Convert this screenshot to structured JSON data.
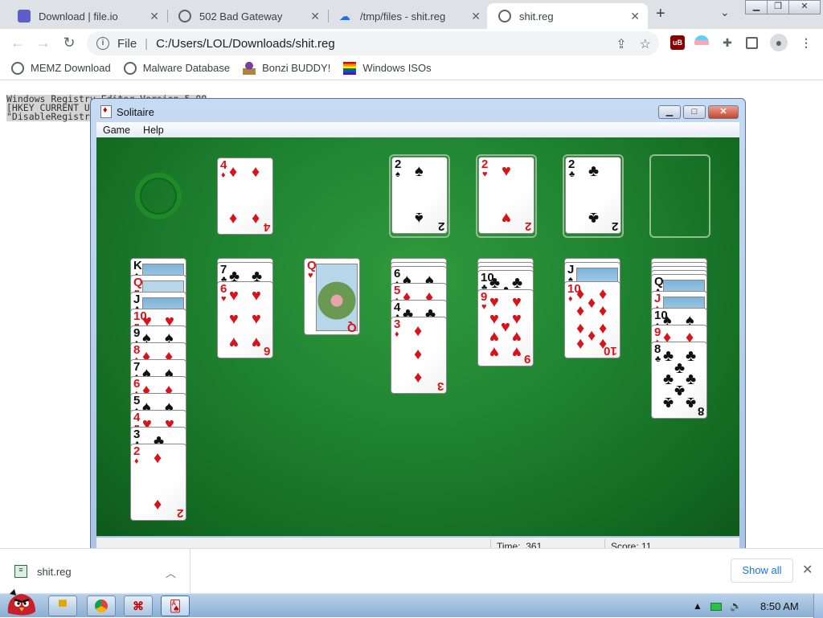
{
  "browser": {
    "tabs": [
      {
        "title": "Download | file.io",
        "favicon_color": "#5b5fc7"
      },
      {
        "title": "502 Bad Gateway",
        "favicon_color": "#5f6368"
      },
      {
        "title": "/tmp/files - shit.reg",
        "favicon_color": "#1a73e8"
      },
      {
        "title": "shit.reg",
        "favicon_color": "#5f6368"
      }
    ],
    "new_tab": "+",
    "tab_menu": "⌄",
    "window_controls": {
      "minimize": "▁",
      "restore": "❐",
      "close": "✕"
    },
    "omnibox": {
      "scheme": "File",
      "separator": "|",
      "url": "C:/Users/LOL/Downloads/shit.reg"
    },
    "bookmarks": [
      {
        "label": "MEMZ Download",
        "icon": "globe-icon"
      },
      {
        "label": "Malware Database",
        "icon": "globe-icon"
      },
      {
        "label": "Bonzi BUDDY!",
        "icon": "bonzi-icon"
      },
      {
        "label": "Windows ISOs",
        "icon": "rainbow-flag-icon"
      }
    ]
  },
  "page_text": {
    "line1": "Windows Registry Editor Version 5.00",
    "line2": "[HKEY_CURRENT_U",
    "line3": "\"DisableRegistr"
  },
  "solitaire": {
    "title": "Solitaire",
    "menu": [
      "Game",
      "Help"
    ],
    "status": {
      "time_label": "Time:",
      "time_value": "361",
      "score_label": "Score:",
      "score_value": "11"
    },
    "waste": {
      "rank": "4",
      "suit": "♦",
      "color": "red"
    },
    "foundations": [
      {
        "rank": "2",
        "suit": "♠",
        "color": "blk"
      },
      {
        "rank": "2",
        "suit": "♥",
        "color": "red"
      },
      {
        "rank": "2",
        "suit": "♣",
        "color": "blk"
      },
      {
        "rank": "",
        "suit": "",
        "color": "empty"
      }
    ],
    "tableau": [
      {
        "face_down": 0,
        "cards": [
          {
            "rank": "K",
            "suit": "♠",
            "color": "blk"
          },
          {
            "rank": "Q",
            "suit": "♥",
            "color": "red"
          },
          {
            "rank": "J",
            "suit": "♣",
            "color": "blk"
          },
          {
            "rank": "10",
            "suit": "♥",
            "color": "red"
          },
          {
            "rank": "9",
            "suit": "♠",
            "color": "blk"
          },
          {
            "rank": "8",
            "suit": "♦",
            "color": "red"
          },
          {
            "rank": "7",
            "suit": "♠",
            "color": "blk"
          },
          {
            "rank": "6",
            "suit": "♦",
            "color": "red"
          },
          {
            "rank": "5",
            "suit": "♠",
            "color": "blk"
          },
          {
            "rank": "4",
            "suit": "♥",
            "color": "red"
          },
          {
            "rank": "3",
            "suit": "♣",
            "color": "blk"
          },
          {
            "rank": "2",
            "suit": "♦",
            "color": "red"
          }
        ]
      },
      {
        "face_down": 1,
        "cards": [
          {
            "rank": "7",
            "suit": "♣",
            "color": "blk"
          },
          {
            "rank": "6",
            "suit": "♥",
            "color": "red"
          }
        ]
      },
      {
        "face_down": 0,
        "cards": [
          {
            "rank": "Q",
            "suit": "♥",
            "color": "red"
          }
        ]
      },
      {
        "face_down": 2,
        "cards": [
          {
            "rank": "6",
            "suit": "♠",
            "color": "blk"
          },
          {
            "rank": "5",
            "suit": "♦",
            "color": "red"
          },
          {
            "rank": "4",
            "suit": "♣",
            "color": "blk"
          },
          {
            "rank": "3",
            "suit": "♦",
            "color": "red"
          }
        ]
      },
      {
        "face_down": 3,
        "cards": [
          {
            "rank": "10",
            "suit": "♣",
            "color": "blk"
          },
          {
            "rank": "9",
            "suit": "♥",
            "color": "red"
          }
        ]
      },
      {
        "face_down": 1,
        "cards": [
          {
            "rank": "J",
            "suit": "♠",
            "color": "blk"
          },
          {
            "rank": "10",
            "suit": "♦",
            "color": "red"
          }
        ]
      },
      {
        "face_down": 4,
        "cards": [
          {
            "rank": "Q",
            "suit": "♣",
            "color": "blk"
          },
          {
            "rank": "J",
            "suit": "♦",
            "color": "red"
          },
          {
            "rank": "10",
            "suit": "♠",
            "color": "blk"
          },
          {
            "rank": "9",
            "suit": "♦",
            "color": "red"
          },
          {
            "rank": "8",
            "suit": "♣",
            "color": "blk"
          }
        ]
      }
    ]
  },
  "downloads": {
    "file": "shit.reg",
    "show_all": "Show all",
    "close": "✕"
  },
  "taskbar": {
    "clock": "8:50 AM"
  },
  "colors": {
    "felt": "#1f8230",
    "red_suit": "#d8141a",
    "link_blue": "#1a73e8"
  }
}
